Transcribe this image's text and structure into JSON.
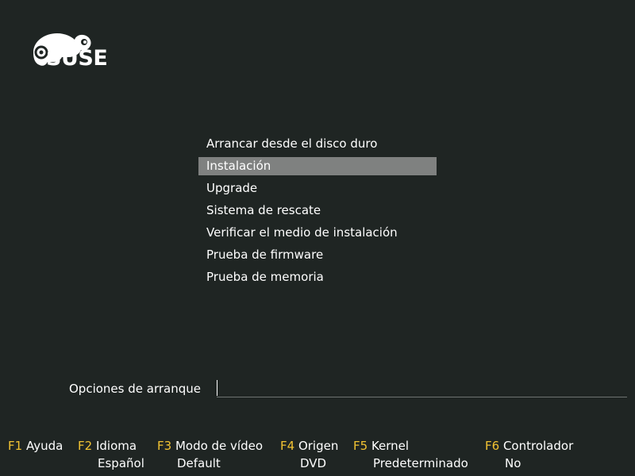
{
  "brand": {
    "logo_icon": "suse-chameleon-icon",
    "logo_text": "SUSE"
  },
  "menu": {
    "items": [
      {
        "label": "Arrancar desde el disco duro",
        "selected": false
      },
      {
        "label": "Instalación",
        "selected": true
      },
      {
        "label": "Upgrade",
        "selected": false
      },
      {
        "label": "Sistema de rescate",
        "selected": false
      },
      {
        "label": "Verificar el medio de instalación",
        "selected": false
      },
      {
        "label": "Prueba de firmware",
        "selected": false
      },
      {
        "label": "Prueba de memoria",
        "selected": false
      }
    ]
  },
  "boot_options": {
    "label": "Opciones de arranque",
    "value": ""
  },
  "function_keys": [
    {
      "key": "F1",
      "label": "Ayuda",
      "value": ""
    },
    {
      "key": "F2",
      "label": "Idioma",
      "value": "Español"
    },
    {
      "key": "F3",
      "label": "Modo de vídeo",
      "value": "Default"
    },
    {
      "key": "F4",
      "label": "Origen",
      "value": "DVD"
    },
    {
      "key": "F5",
      "label": "Kernel",
      "value": "Predeterminado"
    },
    {
      "key": "F6",
      "label": "Controlador",
      "value": "No"
    }
  ],
  "colors": {
    "background": "#1f2523",
    "selection": "#7f8180",
    "function_key": "#f1c232",
    "text": "#ffffff"
  }
}
